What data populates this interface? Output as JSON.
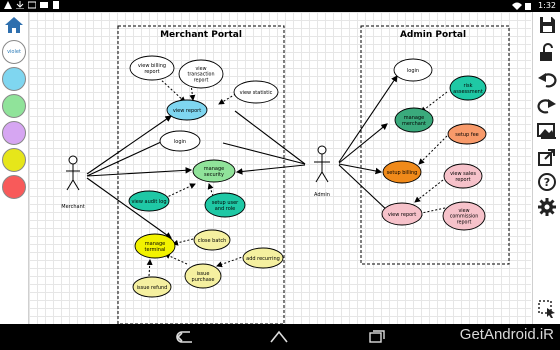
{
  "statusbar": {
    "time": "1:32"
  },
  "palette": {
    "selected_label": "violet",
    "colors": [
      "#ffffff",
      "#7fd6f0",
      "#90e39a",
      "#d6a6f2",
      "#e6e61a",
      "#f85a5a"
    ]
  },
  "diagram": {
    "merchant_boundary": "Merchant Portal",
    "admin_boundary": "Admin Portal",
    "actors": {
      "merchant": "Merchant",
      "admin": "Admin"
    },
    "usecases": {
      "view_billing_report": [
        "view billing",
        "report"
      ],
      "view_transaction_report": [
        "view",
        "transaction",
        "report"
      ],
      "view_statistic": [
        "view statistic"
      ],
      "view_report_m": [
        "view report"
      ],
      "login_m": [
        "login"
      ],
      "manage_security": [
        "manage",
        "security"
      ],
      "view_audit_log": [
        "view audit log"
      ],
      "setup_user_role": [
        "setup user",
        "and role"
      ],
      "manage_terminal": [
        "manage",
        "terminal"
      ],
      "close_batch": [
        "close batch"
      ],
      "add_recurring": [
        "add recurring"
      ],
      "issue_purchase": [
        "issue",
        "purchase"
      ],
      "issue_refund": [
        "issue refund"
      ],
      "login_a": [
        "login"
      ],
      "risk_assessment": [
        "risk",
        "assessment"
      ],
      "manage_merchant": [
        "manage",
        "merchant"
      ],
      "setup_fee": [
        "setup fee"
      ],
      "setup_billing": [
        "setup billing"
      ],
      "view_sales_report": [
        "view sales",
        "report"
      ],
      "view_report_a": [
        "view report"
      ],
      "view_commission_report": [
        "view",
        "commission",
        "report"
      ]
    }
  },
  "watermark": "GetAndroid.iR",
  "icons": {
    "home": "home-icon",
    "save": "save-icon",
    "unlock": "unlock-icon",
    "undo": "undo-icon",
    "redo": "redo-icon",
    "image": "image-icon",
    "share": "share-icon",
    "help": "help-icon",
    "settings": "gear-icon",
    "select": "selection-icon"
  }
}
